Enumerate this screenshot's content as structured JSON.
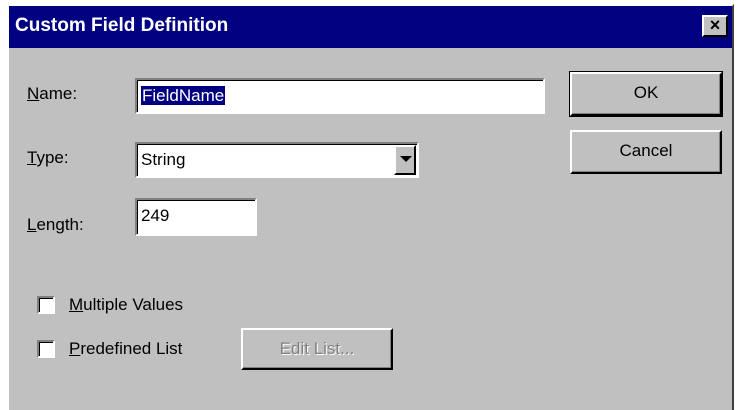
{
  "window": {
    "title": "Custom Field Definition",
    "close_glyph": "×"
  },
  "form": {
    "name": {
      "label_hotkey": "N",
      "label_rest": "ame:",
      "value": "FieldName"
    },
    "type": {
      "label_hotkey": "T",
      "label_rest": "ype:",
      "selected": "String"
    },
    "length": {
      "label_hotkey": "L",
      "label_rest": "ength:",
      "value": "249"
    },
    "multiple_values": {
      "label_hotkey": "M",
      "label_rest": "ultiple Values",
      "checked": false
    },
    "predefined_list": {
      "label_hotkey": "P",
      "label_rest": "redefined List",
      "checked": false
    }
  },
  "buttons": {
    "ok": "OK",
    "cancel": "Cancel",
    "edit_list": "Edit List..."
  },
  "colors": {
    "titlebar": "#000080",
    "face": "#c0c0c0",
    "selection": "#000080",
    "disabled_text": "#808080"
  },
  "icons": {
    "close": "close-icon",
    "dropdown": "chevron-down-icon"
  }
}
